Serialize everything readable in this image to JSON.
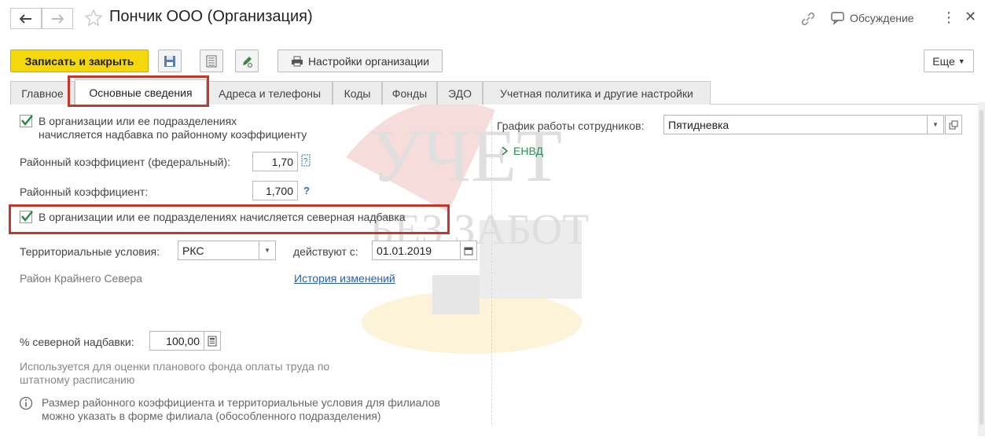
{
  "window": {
    "title": "Пончик ООО (Организация)",
    "discussion_label": "Обсуждение"
  },
  "toolbar": {
    "save_close_label": "Записать и закрыть",
    "org_settings_label": "Настройки организации",
    "more_label": "Еще"
  },
  "tabs": [
    {
      "label": "Главное"
    },
    {
      "label": "Основные сведения"
    },
    {
      "label": "Адреса и телефоны"
    },
    {
      "label": "Коды"
    },
    {
      "label": "Фонды"
    },
    {
      "label": "ЭДО"
    },
    {
      "label": "Учетная политика и другие настройки"
    }
  ],
  "left": {
    "regional_allowance_check": {
      "line1": "В организации или ее подразделениях",
      "line2": "начисляется надбавка по районному коэффициенту",
      "checked": true
    },
    "federal_coef": {
      "label": "Районный коэффициент (федеральный):",
      "value": "1,70"
    },
    "coef": {
      "label": "Районный коэффициент:",
      "value": "1,700",
      "help": "?"
    },
    "north_allowance_check": {
      "label": "В организации или ее подразделениях начисляется северная надбавка",
      "checked": true
    },
    "territorial": {
      "label": "Территориальные условия:",
      "value": "РКС",
      "effective_label": "действуют с:",
      "effective_date": "01.01.2019"
    },
    "territory_name": "Район Крайнего Севера",
    "history_link": "История изменений",
    "north_percent": {
      "label": "% северной надбавки:",
      "value": "100,00"
    },
    "note1_line1": "Используется для оценки планового фонда оплаты труда по",
    "note1_line2": "штатному расписанию",
    "note2_line1": "Размер районного коэффициента и территориальные условия для филиалов",
    "note2_line2": "можно указать в форме филиала (обособленного подразделения)"
  },
  "right": {
    "schedule": {
      "label": "График работы сотрудников:",
      "value": "Пятидневка"
    },
    "envd_group": "ЕНВД"
  },
  "watermark": {
    "line1": "УЧЕТ",
    "line2": "БЕЗ ЗАБОТ"
  },
  "colors": {
    "accent": "#f5d80c",
    "highlight": "#c0392b",
    "check": "#1f8a3a",
    "link": "#2a5fa8"
  }
}
